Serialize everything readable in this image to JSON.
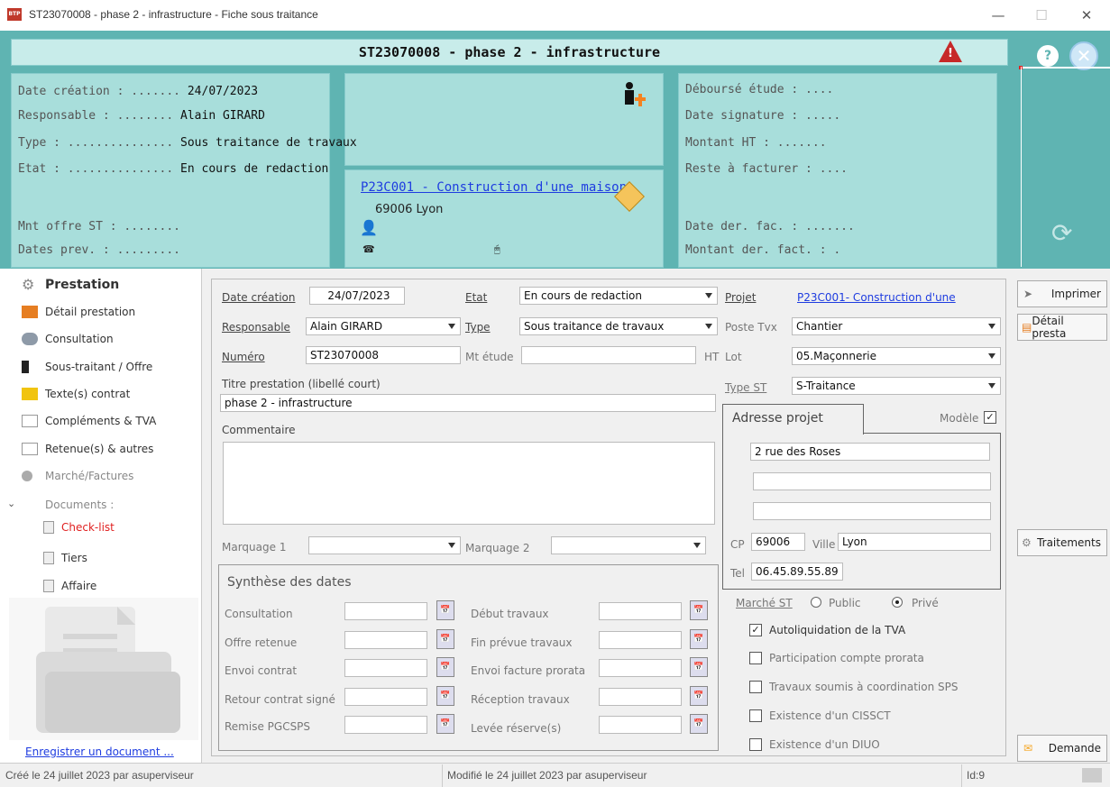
{
  "window": {
    "title": "ST23070008 - phase 2 - infrastructure - Fiche sous traitance",
    "app_icon": "BTP",
    "minimize": "—",
    "maximize": "☐",
    "close": "✕"
  },
  "header": {
    "title": "ST23070008 - phase 2 - infrastructure",
    "left": {
      "date_creation_label": "Date création : .......",
      "date_creation": "24/07/2023",
      "responsable_label": "Responsable : ........",
      "responsable": "Alain GIRARD",
      "type_label": "Type : ...............",
      "type": "Sous traitance de travaux",
      "etat_label": "Etat : ...............",
      "etat": "En cours de redaction",
      "mnt_offre_label": "Mnt offre ST : ........",
      "dates_prev_label": "Dates prev. : ........."
    },
    "project": {
      "link": "P23C001 - Construction d'une maison",
      "city": "69006 Lyon"
    },
    "right": {
      "debourse_label": "Déboursé étude : ....",
      "date_signature_label": "Date signature : .....",
      "montant_ht_label": "Montant HT : .......",
      "reste_label": "Reste à facturer : ....",
      "date_der_fac_label": "Date der. fac. : .......",
      "montant_der_label": "Montant der. fact. : ."
    }
  },
  "sidebar": {
    "heading": "Prestation",
    "items": [
      "Détail prestation",
      "Consultation",
      "Sous-traitant / Offre",
      "Texte(s) contrat",
      "Compléments & TVA",
      "Retenue(s) & autres",
      "Marché/Factures"
    ],
    "documents_label": "Documents :",
    "doc_items": [
      "Check-list",
      "Tiers",
      "Affaire"
    ],
    "enreg_link": "Enregistrer un document ..."
  },
  "form": {
    "date_creation_label": "Date création",
    "date_creation": "24/07/2023",
    "etat_label": "Etat",
    "etat": "En cours de redaction",
    "projet_label": "Projet",
    "projet": "P23C001- Construction d'une",
    "responsable_label": "Responsable",
    "responsable": "Alain GIRARD",
    "type_label": "Type",
    "type": "Sous traitance de travaux",
    "poste_tvx_label": "Poste Tvx",
    "poste_tvx": "Chantier",
    "numero_label": "Numéro",
    "numero": "ST23070008",
    "mt_etude_label": "Mt étude",
    "mt_etude": "",
    "ht_label": "HT",
    "lot_label": "Lot",
    "lot": "05.Maçonnerie",
    "titre_label": "Titre prestation (libellé court)",
    "titre": "phase 2 - infrastructure",
    "type_st_label": "Type ST",
    "type_st": "S-Traitance",
    "commentaire_label": "Commentaire",
    "commentaire": "",
    "marquage1_label": "Marquage 1",
    "marquage1": "",
    "marquage2_label": "Marquage 2",
    "marquage2": "",
    "adresse": {
      "tab": "Adresse projet",
      "modele_label": "Modèle",
      "modele_checked": "✓",
      "line1": "2 rue des Roses",
      "line2": "",
      "line3": "",
      "cp_label": "CP",
      "cp": "69006",
      "ville_label": "Ville",
      "ville": "Lyon",
      "tel_label": "Tel",
      "tel": "06.45.89.55.89"
    },
    "dates": {
      "title": "Synthèse des dates",
      "left": [
        "Consultation",
        "Offre retenue",
        "Envoi contrat",
        "Retour contrat signé",
        "Remise PGCSPS"
      ],
      "right": [
        "Début travaux",
        "Fin prévue travaux",
        "Envoi facture prorata",
        "Réception travaux",
        "Levée réserve(s)"
      ]
    },
    "marche": {
      "label": "Marché ST",
      "public": "Public",
      "prive": "Privé",
      "selected": "Privé"
    },
    "checks": [
      {
        "label": "Autoliquidation de la TVA",
        "mark": "✓"
      },
      {
        "label": "Participation compte prorata",
        "mark": ""
      },
      {
        "label": "Travaux soumis à coordination SPS",
        "mark": ""
      },
      {
        "label": "Existence d'un CISSCT",
        "mark": ""
      },
      {
        "label": "Existence d'un DIUO",
        "mark": ""
      }
    ]
  },
  "actions": {
    "imprimer": "Imprimer",
    "detail": "Détail presta",
    "traitements": "Traitements",
    "demande": "Demande"
  },
  "status": {
    "created": "Créé le 24 juillet 2023 par asuperviseur",
    "modified": "Modifié le 24 juillet 2023 par asuperviseur",
    "id": "Id:9"
  },
  "colors": {
    "band": "#5fb4b2",
    "panel": "#a8dedb",
    "link": "#1e3ce0",
    "warning": "#c62828",
    "checklist": "#e02020"
  }
}
